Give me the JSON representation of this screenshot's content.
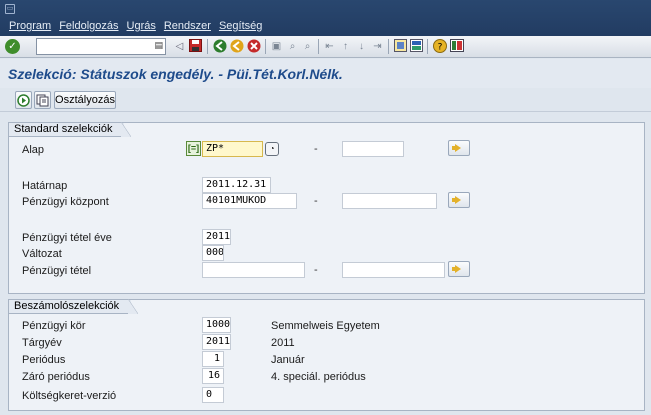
{
  "menubar": {
    "items": [
      {
        "label": "Program"
      },
      {
        "label": "Feldolgozás"
      },
      {
        "label": "Ugrás"
      },
      {
        "label": "Rendszer"
      },
      {
        "label": "Segítség"
      }
    ]
  },
  "toolbar": {
    "command_value": "",
    "icons": [
      "enter-icon",
      "back-icon",
      "save-icon",
      "back-nav-icon",
      "exit-icon",
      "cancel-icon",
      "print-icon",
      "find-icon",
      "find-next-icon",
      "first-page-icon",
      "prev-page-icon",
      "next-page-icon",
      "last-page-icon",
      "new-session-icon",
      "shortcut-icon",
      "help-icon",
      "layout-icon"
    ]
  },
  "title": "Szelekció: Státuszok engedély. - Püi.Tét.Korl.Nélk.",
  "apptool": {
    "execute_icon": "execute-icon",
    "variant_icon": "variant-icon",
    "button_label": "Osztályozás"
  },
  "standard": {
    "title": "Standard szelekciók",
    "alap": {
      "label": "Alap",
      "value": "ZP*",
      "to": ""
    },
    "hatarnap": {
      "label": "Határnap",
      "value": "2011.12.31"
    },
    "kozpont": {
      "label": "Pénzügyi központ",
      "value": "40101MUKOD",
      "to": ""
    },
    "ev": {
      "label": "Pénzügyi tétel éve",
      "value": "2011"
    },
    "valtozat": {
      "label": "Változat",
      "value": "000"
    },
    "tetel": {
      "label": "Pénzügyi tétel",
      "value": "",
      "to": ""
    },
    "dash": "-"
  },
  "beszamolo": {
    "title": "Beszámolószelekciók",
    "kor": {
      "label": "Pénzügyi kör",
      "value": "1000",
      "text": "Semmelweis Egyetem"
    },
    "targyev": {
      "label": "Tárgyév",
      "value": "2011",
      "text": "2011"
    },
    "periodus": {
      "label": "Periódus",
      "value": "1",
      "text": "Január"
    },
    "zaro": {
      "label": "Záró periódus",
      "value": "16",
      "text": "4. speciál. periódus"
    },
    "verzio": {
      "label": "Költségkeret-verzió",
      "value": "0"
    }
  }
}
